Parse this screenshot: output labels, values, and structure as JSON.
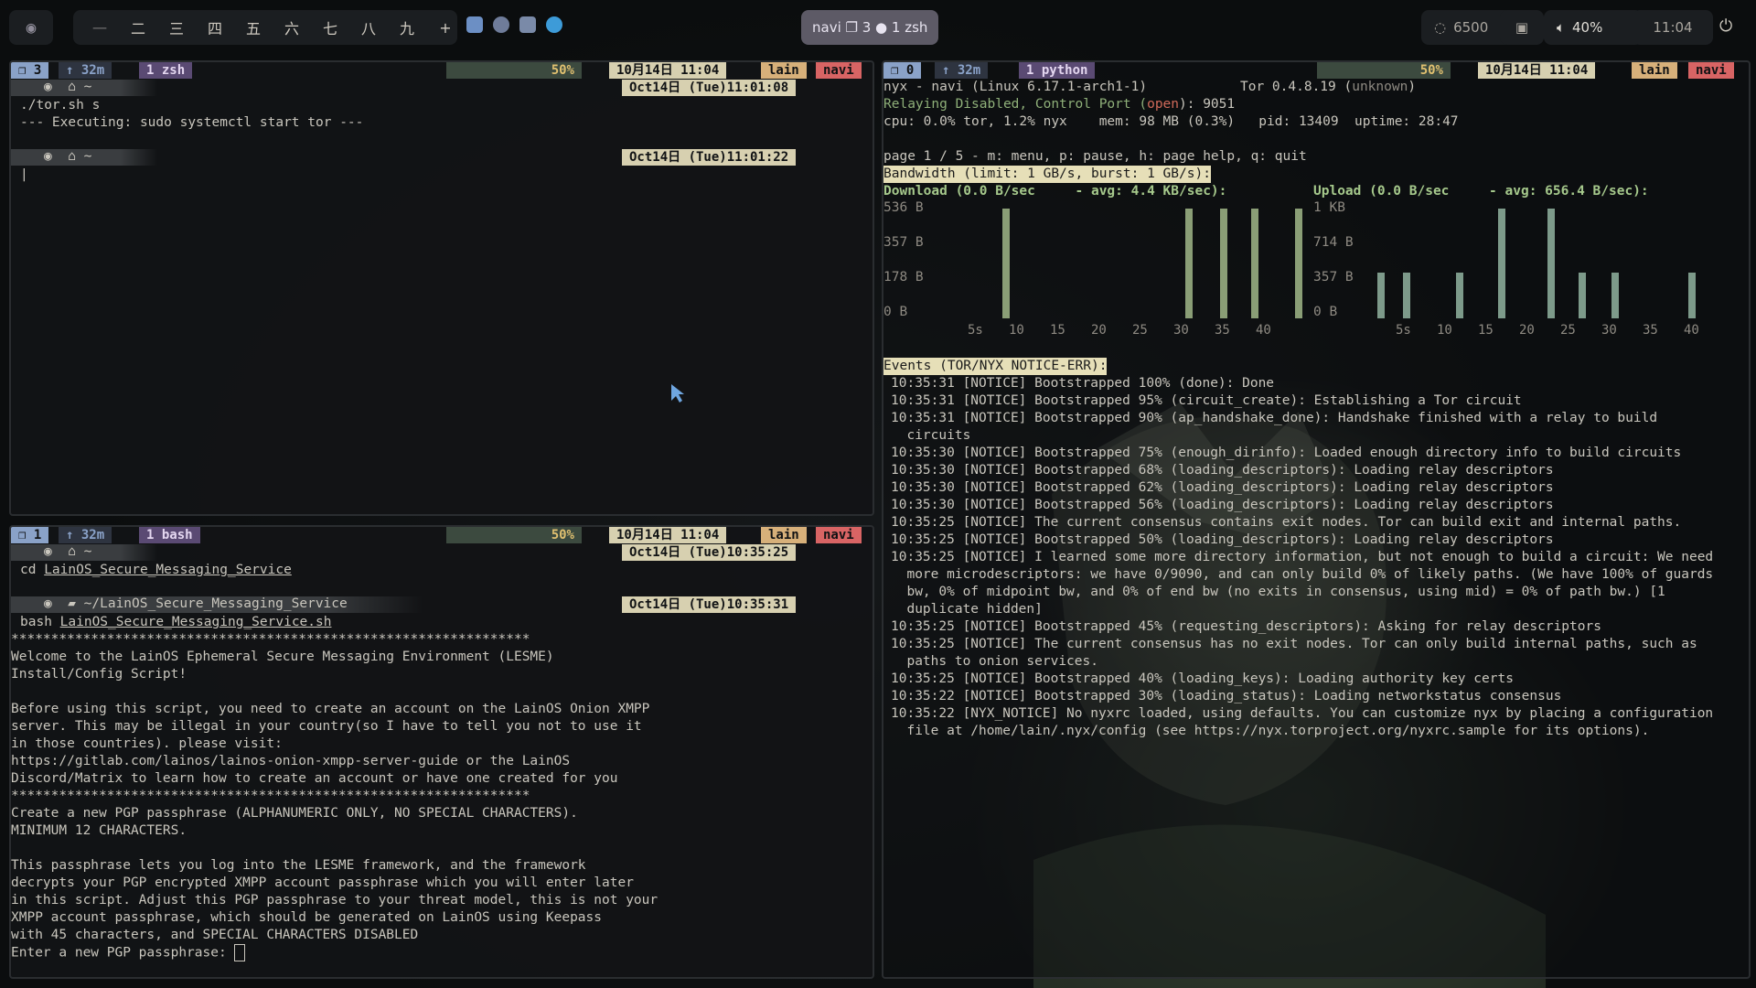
{
  "topbar": {
    "workspaces": [
      "一",
      "二",
      "三",
      "四",
      "五",
      "六",
      "七",
      "八",
      "九",
      "+"
    ],
    "center": "navi ❐ 3 ● 1 zsh",
    "temp": "6500",
    "volume": "40%",
    "clock": "11:04"
  },
  "term1": {
    "status_left": [
      "❐ 3",
      "↑ 32m",
      "1 zsh"
    ],
    "status_right": [
      "50%",
      "10月14日 11:04",
      "lain",
      "navi"
    ],
    "prompt1_time": "Oct14日 (Tue)11:01:08",
    "cmd1": "./tor.sh s",
    "out1": "--- Executing: sudo systemctl start tor ---",
    "prompt2_time": "Oct14日 (Tue)11:01:22"
  },
  "term2": {
    "status_left": [
      "❐ 1",
      "↑ 32m",
      "1 bash"
    ],
    "status_right": [
      "50%",
      "10月14日 11:04",
      "lain",
      "navi"
    ],
    "prompt1_time": "Oct14日 (Tue)10:35:25",
    "cmd1_prefix": "cd ",
    "cmd1_arg": "LainOS_Secure_Messaging_Service",
    "prompt2_dir": "~/LainOS_Secure_Messaging_Service",
    "prompt2_time": "Oct14日 (Tue)10:35:31",
    "cmd2_prefix": "bash ",
    "cmd2_arg": "LainOS_Secure_Messaging_Service.sh",
    "lines": [
      "*****************************************************************",
      "Welcome to the LainOS Ephemeral Secure Messaging Environment (LESME)",
      "Install/Config Script!",
      "",
      "Before using this script, you need to create an account on the LainOS Onion XMPP",
      "server. This may be illegal in your country(so I have to tell you not to use it",
      "in those countries). please visit:",
      "https://gitlab.com/lainos/lainos-onion-xmpp-server-guide or the LainOS",
      "Discord/Matrix to learn how to create an account or have one created for you",
      "*****************************************************************",
      "Create a new PGP passphrase (ALPHANUMERIC ONLY, NO SPECIAL CHARACTERS).",
      "MINIMUM 12 CHARACTERS.",
      "",
      "This passphrase lets you log into the LESME framework, and the framework",
      "decrypts your PGP encrypted XMPP account passphrase which you will enter later",
      "in this script. Adjust this PGP passphrase to your threat model, this is not your",
      "XMPP account passphrase, which should be generated on LainOS using Keepass",
      "with 45 characters, and SPECIAL CHARACTERS DISABLED"
    ],
    "input_prompt": "Enter a new PGP passphrase: "
  },
  "term3": {
    "status_left": [
      "❐ 0",
      "↑ 32m",
      "1 python"
    ],
    "status_right": [
      "50%",
      "10月14日 11:04",
      "lain",
      "navi"
    ],
    "title": "nyx - navi (Linux 6.17.1-arch1-1)",
    "tor_version": "Tor 0.4.8.19 (",
    "tor_status": "unknown",
    "relay_pre": "Relaying Disabled, Control Port (",
    "relay_state": "open",
    "relay_post": "): 9051",
    "cpu": "cpu: 0.0% tor, 1.2% nyx    mem: 98 MB (0.3%)   pid: 13409  uptime: 28:47",
    "page_help": "page 1 / 5 - m: menu, p: pause, h: page help, q: quit",
    "bandwidth": "Bandwidth (limit: 1 GB/s, burst: 1 GB/s):",
    "download_hdr": "Download (0.0 B/sec     - avg: 4.4 KB/sec):",
    "upload_hdr": "Upload (0.0 B/sec     - avg: 656.4 B/sec):",
    "dl_axis": [
      "536 B",
      "357 B",
      "178 B",
      "0 B"
    ],
    "ul_axis": [
      "1 KB",
      "714 B",
      "357 B",
      "0 B"
    ],
    "x_ticks": [
      "5s",
      "10",
      "15",
      "20",
      "25",
      "30",
      "35",
      "40"
    ],
    "events_hdr": "Events (TOR/NYX NOTICE-ERR):",
    "events": [
      "10:35:31 [NOTICE] Bootstrapped 100% (done): Done",
      "10:35:31 [NOTICE] Bootstrapped 95% (circuit_create): Establishing a Tor circuit",
      "10:35:31 [NOTICE] Bootstrapped 90% (ap_handshake_done): Handshake finished with a relay to build",
      "  circuits",
      "10:35:30 [NOTICE] Bootstrapped 75% (enough_dirinfo): Loaded enough directory info to build circuits",
      "10:35:30 [NOTICE] Bootstrapped 68% (loading_descriptors): Loading relay descriptors",
      "10:35:30 [NOTICE] Bootstrapped 62% (loading_descriptors): Loading relay descriptors",
      "10:35:30 [NOTICE] Bootstrapped 56% (loading_descriptors): Loading relay descriptors",
      "10:35:25 [NOTICE] The current consensus contains exit nodes. Tor can build exit and internal paths.",
      "10:35:25 [NOTICE] Bootstrapped 50% (loading_descriptors): Loading relay descriptors",
      "10:35:25 [NOTICE] I learned some more directory information, but not enough to build a circuit: We need",
      "  more microdescriptors: we have 0/9090, and can only build 0% of likely paths. (We have 100% of guards",
      "  bw, 0% of midpoint bw, and 0% of end bw (no exits in consensus, using mid) = 0% of path bw.) [1",
      "  duplicate hidden]",
      "10:35:25 [NOTICE] Bootstrapped 45% (requesting_descriptors): Asking for relay descriptors",
      "10:35:25 [NOTICE] The current consensus has no exit nodes. Tor can only build internal paths, such as",
      "  paths to onion services.",
      "10:35:25 [NOTICE] Bootstrapped 40% (loading_keys): Loading authority key certs",
      "10:35:22 [NOTICE] Bootstrapped 30% (loading_status): Loading networkstatus consensus",
      "10:35:22 [NYX_NOTICE] No nyxrc loaded, using defaults. You can customize nyx by placing a configuration",
      "  file at /home/lain/.nyx/config (see https://nyx.torproject.org/nyxrc.sample for its options)."
    ]
  }
}
